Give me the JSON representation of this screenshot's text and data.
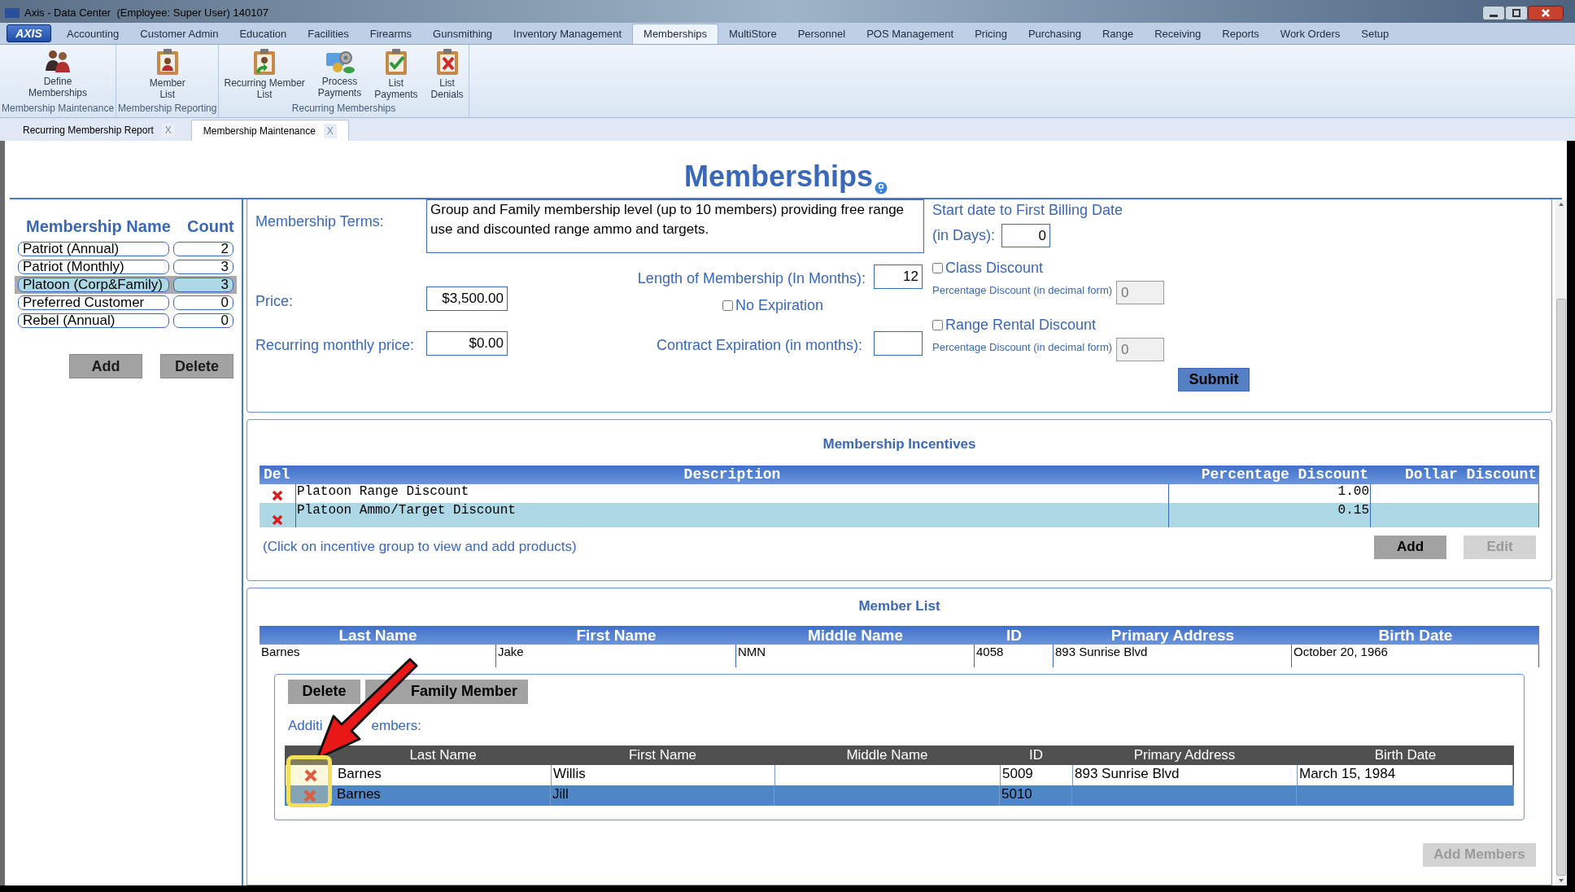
{
  "window": {
    "title": "Axis - Data Center  (Employee: Super User) 140107"
  },
  "logo": "AXIS",
  "menu_tabs": [
    {
      "label": "Accounting",
      "selected": false
    },
    {
      "label": "Customer Admin",
      "selected": false
    },
    {
      "label": "Education",
      "selected": false
    },
    {
      "label": "Facilities",
      "selected": false
    },
    {
      "label": "Firearms",
      "selected": false
    },
    {
      "label": "Gunsmithing",
      "selected": false
    },
    {
      "label": "Inventory Management",
      "selected": false
    },
    {
      "label": "Memberships",
      "selected": true
    },
    {
      "label": "MultiStore",
      "selected": false
    },
    {
      "label": "Personnel",
      "selected": false
    },
    {
      "label": "POS Management",
      "selected": false
    },
    {
      "label": "Pricing",
      "selected": false
    },
    {
      "label": "Purchasing",
      "selected": false
    },
    {
      "label": "Range",
      "selected": false
    },
    {
      "label": "Receiving",
      "selected": false
    },
    {
      "label": "Reports",
      "selected": false
    },
    {
      "label": "Work Orders",
      "selected": false
    },
    {
      "label": "Setup",
      "selected": false
    }
  ],
  "ribbon_groups": [
    {
      "label": "Membership Maintenance",
      "items": [
        {
          "label": "Define\nMemberships"
        }
      ]
    },
    {
      "label": "Membership Reporting",
      "items": [
        {
          "label": "Member\nList"
        }
      ]
    },
    {
      "label": "Recurring Memberships",
      "items": [
        {
          "label": "Recurring Member\nList"
        },
        {
          "label": "Process\nPayments"
        },
        {
          "label": "List\nPayments"
        },
        {
          "label": "List\nDenials"
        }
      ]
    }
  ],
  "doc_tabs": [
    {
      "label": "Recurring Membership Report",
      "close": "X",
      "selected": false
    },
    {
      "label": "Membership Maintenance",
      "close": "X",
      "selected": true
    }
  ],
  "heading": "Memberships",
  "membership_list": {
    "columns": [
      "Membership Name",
      "Count"
    ],
    "items": [
      {
        "name": "Patriot (Annual)",
        "count": "2",
        "selected": false
      },
      {
        "name": "Patriot (Monthly)",
        "count": "3",
        "selected": false
      },
      {
        "name": "Platoon (Corp&Family)",
        "count": "3",
        "selected": true
      },
      {
        "name": "Preferred Customer",
        "count": "0",
        "selected": false
      },
      {
        "name": "Rebel (Annual)",
        "count": "0",
        "selected": false
      }
    ],
    "buttons": [
      "Add",
      "Delete"
    ]
  },
  "form": {
    "terms_label": "Membership Terms:",
    "terms_text": "Group and Family membership level (up to 10 members) providing free range use and discounted range ammo and targets.",
    "price_label": "Price:",
    "price": "$3,500.00",
    "recurring_label": "Recurring monthly price:",
    "recurring_price": "$0.00",
    "length_label": "Length of Membership (In Months):",
    "length": "12",
    "no_expiration": {
      "label": "No Expiration",
      "checked": false
    },
    "contract_label": "Contract Expiration (in months):",
    "start_label": "Start date to First Billing Date",
    "days_label": "(in Days):",
    "days": "0",
    "discounts": [
      {
        "label": "Class Discount",
        "checked": false,
        "pct_label": "Percentage Discount (in decimal form)",
        "pct_value": "0"
      },
      {
        "label": "Range Rental Discount",
        "checked": false,
        "pct_label": "Percentage Discount (in decimal form)",
        "pct_value": "0"
      }
    ],
    "submit": "Submit"
  },
  "incentives": {
    "title": "Membership Incentives",
    "columns": [
      "Del",
      "Description",
      "Percentage Discount",
      "Dollar Discount"
    ],
    "rows": [
      {
        "description": "Platoon Range Discount",
        "percentage": "1.00",
        "selected": false
      },
      {
        "description": "Platoon Ammo/Target Discount",
        "percentage": "0.15",
        "selected": true
      }
    ],
    "hint": "(Click on incentive group to view and add products)",
    "buttons": [
      {
        "label": "Add",
        "disabled": false
      },
      {
        "label": "Edit",
        "disabled": true
      }
    ]
  },
  "member_list": {
    "title": "Member List",
    "columns": [
      "Last Name",
      "First Name",
      "Middle Name",
      "ID",
      "Primary Address",
      "Birth Date"
    ],
    "rows": [
      {
        "cells": [
          "Barnes",
          "Jake",
          "NMN",
          "4058",
          "893 Sunrise Blvd",
          "October 20, 1966"
        ]
      }
    ],
    "buttons": [
      {
        "label": "Delete"
      },
      {
        "label": "Family Member"
      }
    ],
    "additional_label": [
      "Additi",
      "embers:"
    ],
    "additional": {
      "columns": [
        "Last Name",
        "First Name",
        "Middle Name",
        "ID",
        "Primary Address",
        "Birth Date"
      ],
      "rows": [
        {
          "cells": [
            "Barnes",
            "Willis",
            "",
            "5009",
            "893 Sunrise Blvd",
            "March 15, 1984"
          ],
          "selected": false
        },
        {
          "cells": [
            "Barnes",
            "Jill",
            "",
            "5010",
            "",
            ""
          ],
          "selected": true
        }
      ]
    },
    "add_members": {
      "label": "Add Members",
      "disabled": true
    }
  },
  "annotations": [
    {
      "kind": "arrow"
    },
    {
      "kind": "highlight"
    }
  ]
}
